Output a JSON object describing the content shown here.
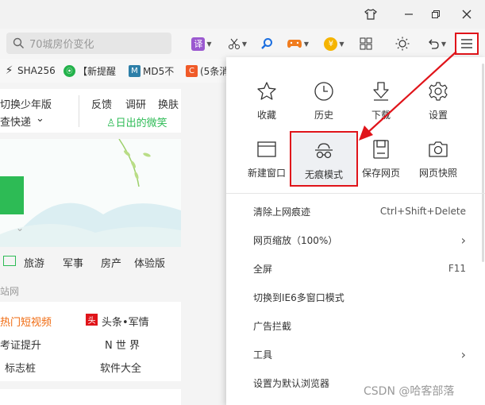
{
  "window": {
    "buttons": [
      "tshirt-icon",
      "minimize-icon",
      "restore-icon",
      "close-icon"
    ]
  },
  "search": {
    "placeholder": "70城房价变化"
  },
  "toolbar": {
    "translate_label": "译"
  },
  "bookmarks": [
    {
      "label": "SHA256",
      "icon_color": "#333333"
    },
    {
      "label": "【新提醒",
      "icon_color": "#23b24b"
    },
    {
      "label": "MD5不",
      "icon_color": "#2d7fa8",
      "icon_text": "M"
    },
    {
      "label": "(5条消",
      "icon_color": "#f05a28",
      "icon_text": "C"
    }
  ],
  "page": {
    "top_left": [
      "切换少年版",
      "查快递"
    ],
    "top_right": [
      "反馈",
      "调研",
      "换肤"
    ],
    "greeting": "日出的微笑",
    "nav": [
      "旅游",
      "军事",
      "房产",
      "体验版"
    ],
    "section_label": "站网",
    "links": [
      [
        "热门短视频",
        "头条•军情"
      ],
      [
        "考证提升",
        "N 世 界"
      ],
      [
        "标志桩",
        "软件大全"
      ]
    ],
    "badge": "头",
    "accent": "#e0141a",
    "orange": "#f06a0f",
    "green": "#2dbb55"
  },
  "menu": {
    "grid": [
      {
        "label": "收藏",
        "icon": "star-icon"
      },
      {
        "label": "历史",
        "icon": "clock-icon"
      },
      {
        "label": "下载",
        "icon": "download-icon"
      },
      {
        "label": "设置",
        "icon": "gear-icon"
      },
      {
        "label": "新建窗口",
        "icon": "window-icon"
      },
      {
        "label": "无痕模式",
        "icon": "incognito-icon"
      },
      {
        "label": "保存网页",
        "icon": "save-icon"
      },
      {
        "label": "网页快照",
        "icon": "camera-icon"
      }
    ],
    "items": [
      {
        "label": "清除上网痕迹",
        "right": "Ctrl+Shift+Delete"
      },
      {
        "label": "网页缩放（100%）",
        "right": "›"
      },
      {
        "label": "全屏",
        "right": "F11"
      },
      {
        "label": "切换到IE6多窗口模式",
        "right": ""
      },
      {
        "label": "广告拦截",
        "right": ""
      },
      {
        "label": "工具",
        "right": "›"
      },
      {
        "label": "设置为默认浏览器",
        "right": ""
      }
    ]
  },
  "watermark": "CSDN @哈客部落"
}
